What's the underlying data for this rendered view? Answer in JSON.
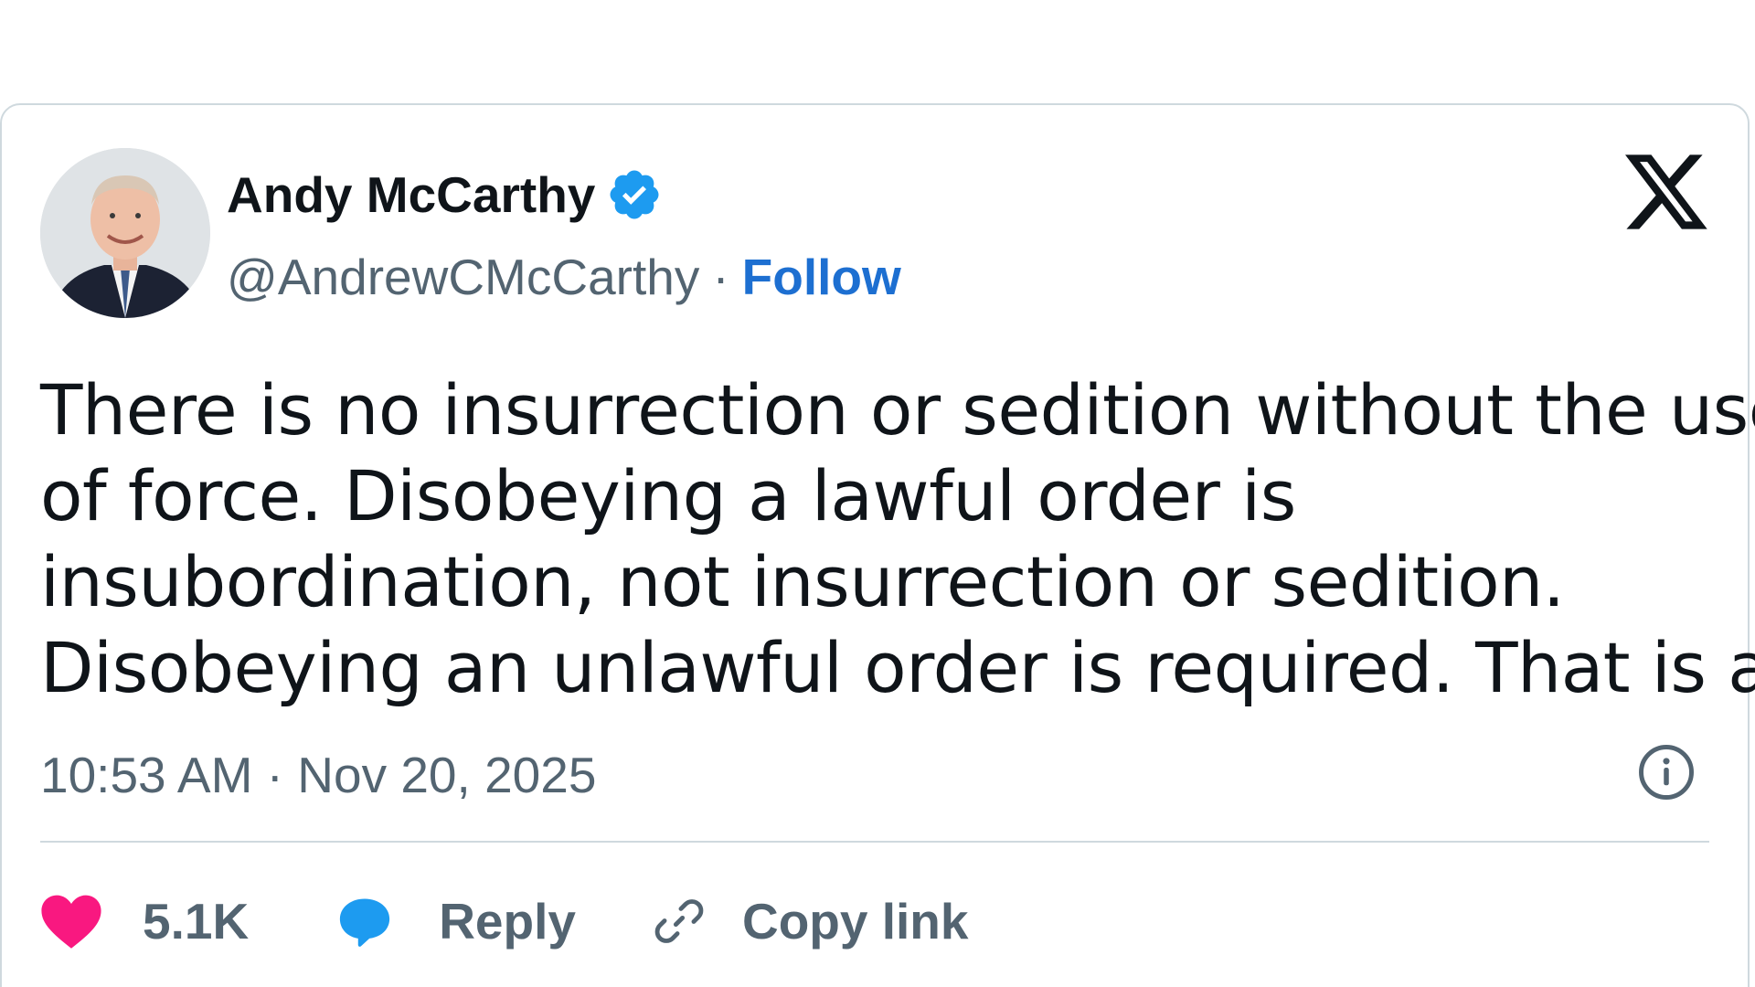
{
  "tweet": {
    "author": {
      "name": "Andy McCarthy",
      "handle": "@AndrewCMcCarthy",
      "separator": "·",
      "follow_label": "Follow",
      "verified": true,
      "verified_icon": "verified-badge-icon",
      "avatar": "profile-photo"
    },
    "platform_logo": "x-logo-icon",
    "text_lines": [
      "There is no insurrection or sedition without the use",
      "of force. Disobeying a lawful order is",
      "insubordination, not insurrection or sedition.",
      "Disobeying an unlawful order is required. That is all."
    ],
    "timestamp": "10:53 AM · Nov 20, 2025",
    "info_icon": "info-icon",
    "actions": {
      "like_count": "5.1K",
      "reply_label": "Reply",
      "copy_link_label": "Copy link"
    }
  },
  "colors": {
    "link_blue": "#1d6fd1",
    "verified_blue": "#1d9bf0",
    "like_pink": "#f91880",
    "text_primary": "#0f1419",
    "text_secondary": "#536471",
    "border": "#cfd9de"
  }
}
